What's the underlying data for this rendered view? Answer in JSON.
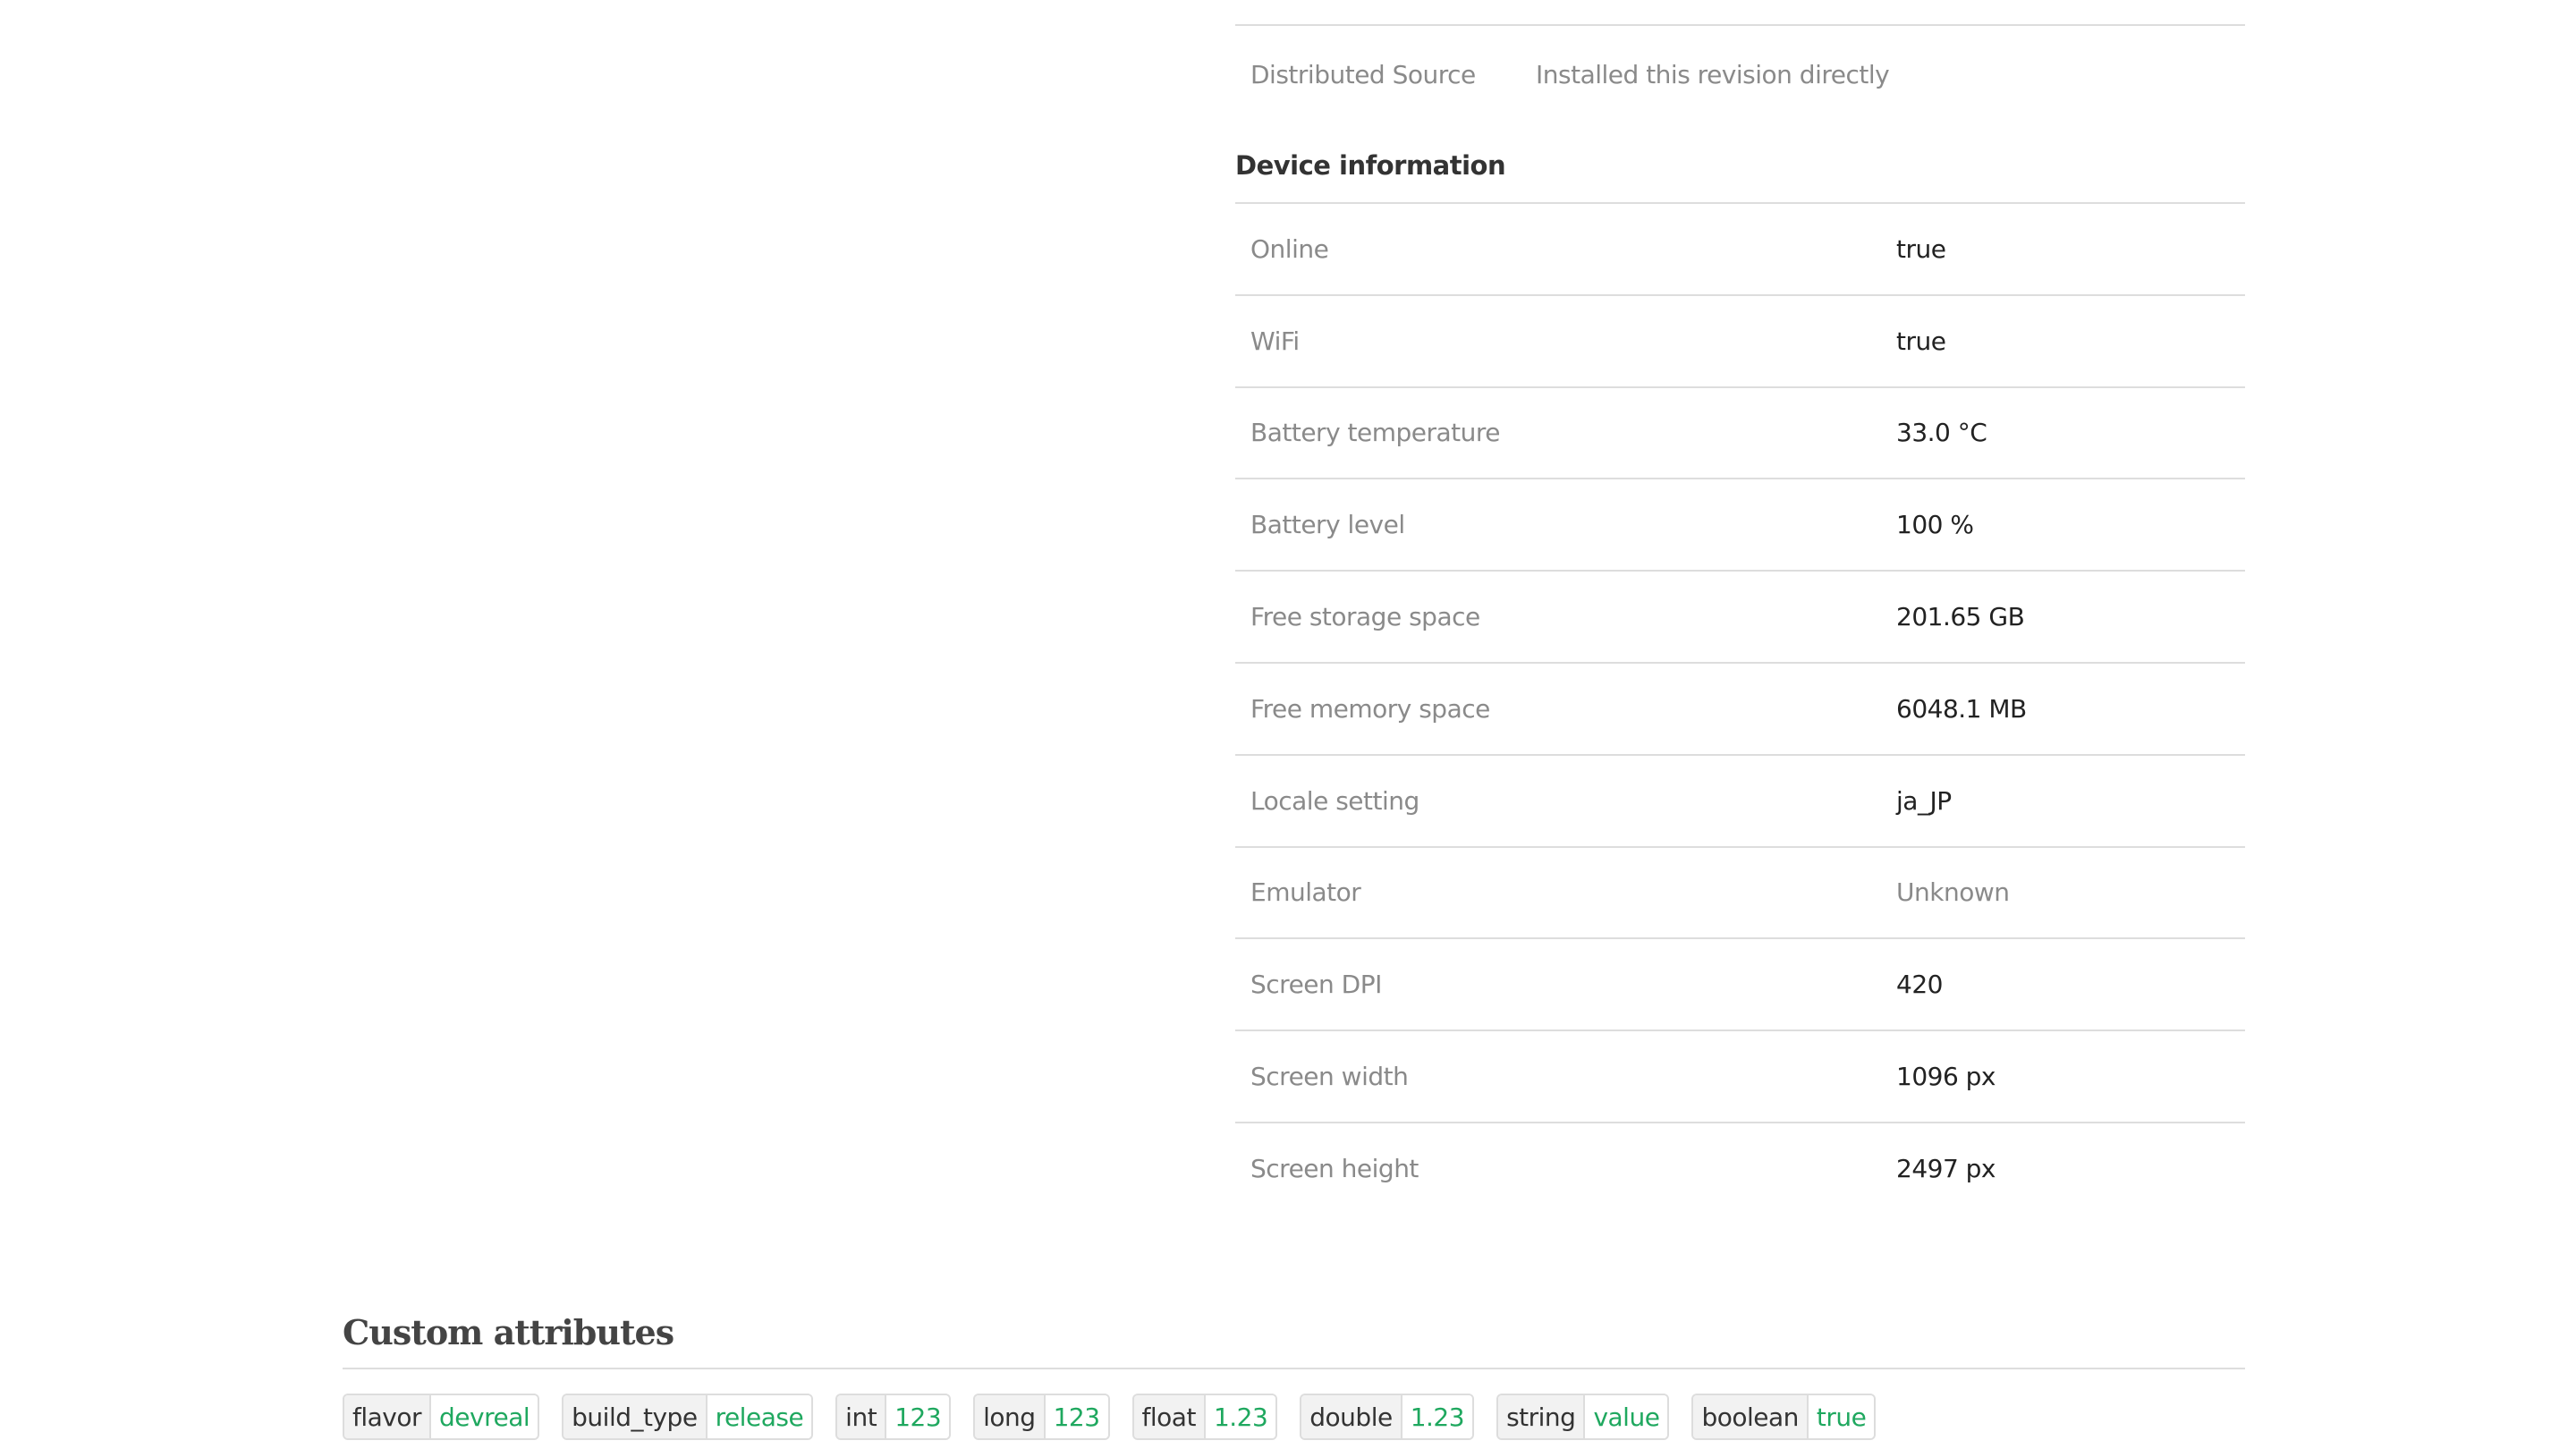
{
  "distribution": {
    "rows": [
      {
        "label": "Distributed Source",
        "value": "Installed this revision directly"
      }
    ]
  },
  "device_information": {
    "title": "Device information",
    "rows": [
      {
        "label": "Online",
        "value": "true",
        "muted": false
      },
      {
        "label": "WiFi",
        "value": "true",
        "muted": false
      },
      {
        "label": "Battery temperature",
        "value": "33.0 °C",
        "muted": false
      },
      {
        "label": "Battery level",
        "value": "100 %",
        "muted": false
      },
      {
        "label": "Free storage space",
        "value": "201.65 GB",
        "muted": false
      },
      {
        "label": "Free memory space",
        "value": "6048.1 MB",
        "muted": false
      },
      {
        "label": "Locale setting",
        "value": "ja_JP",
        "muted": false
      },
      {
        "label": "Emulator",
        "value": "Unknown",
        "muted": true
      },
      {
        "label": "Screen DPI",
        "value": "420",
        "muted": false
      },
      {
        "label": "Screen width",
        "value": "1096 px",
        "muted": false
      },
      {
        "label": "Screen height",
        "value": "2497 px",
        "muted": false
      }
    ]
  },
  "custom_attributes": {
    "title": "Custom attributes",
    "value_color": "#1fa85f",
    "items": [
      {
        "name": "flavor",
        "value": "devreal"
      },
      {
        "name": "build_type",
        "value": "release"
      },
      {
        "name": "int",
        "value": "123"
      },
      {
        "name": "long",
        "value": "123"
      },
      {
        "name": "float",
        "value": "1.23"
      },
      {
        "name": "double",
        "value": "1.23"
      },
      {
        "name": "string",
        "value": "value"
      },
      {
        "name": "boolean",
        "value": "true"
      }
    ]
  }
}
